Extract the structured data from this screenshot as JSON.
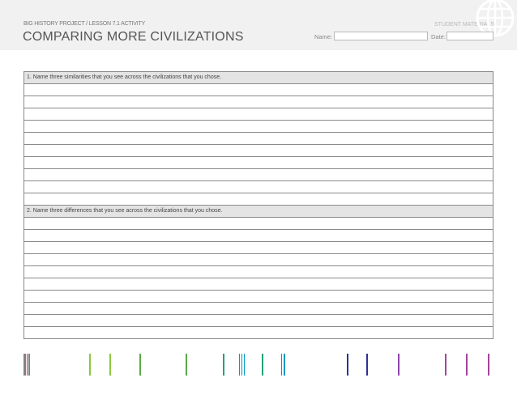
{
  "header": {
    "kicker": "BIG HISTORY PROJECT / LESSON 7.1 ACTIVITY",
    "title": "COMPARING MORE CIVILIZATIONS",
    "student_materials": "STUDENT MATERIALS",
    "name_label": "Name:",
    "name_value": "",
    "date_label": "Date:",
    "date_value": "",
    "logo_icon": "globe-icon"
  },
  "questions": [
    {
      "prompt": "1.  Name three similarities that you see across the civilizations that you chose.",
      "answer_lines": 10
    },
    {
      "prompt": "2. Name three differences that you see across the civilizations that you chose.",
      "answer_lines": 10
    }
  ],
  "footer": {
    "bar_colors": [
      "#808285",
      "#c0392b",
      "#8cc63f",
      "#5aaa46",
      "#21a179",
      "#0099c4",
      "#2e3192",
      "#8e44ad",
      "#a4449a"
    ]
  }
}
